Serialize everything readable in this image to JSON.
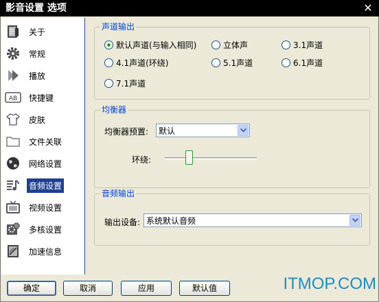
{
  "window": {
    "title": "影音设置 选项",
    "close_glyph": "✕"
  },
  "sidebar": {
    "items": [
      {
        "label": "关于",
        "icon": "about-icon"
      },
      {
        "label": "常规",
        "icon": "gear-icon"
      },
      {
        "label": "播放",
        "icon": "play-icon"
      },
      {
        "label": "快捷键",
        "icon": "keyboard-icon"
      },
      {
        "label": "皮肤",
        "icon": "shirt-icon"
      },
      {
        "label": "文件关联",
        "icon": "folder-icon"
      },
      {
        "label": "网络设置",
        "icon": "globe-icon"
      },
      {
        "label": "音频设置",
        "icon": "audio-icon",
        "selected": true
      },
      {
        "label": "视频设置",
        "icon": "tv-icon"
      },
      {
        "label": "多核设置",
        "icon": "multicore-icon"
      },
      {
        "label": "加速信息",
        "icon": "speed-icon"
      }
    ]
  },
  "channel_output": {
    "title": "声道输出",
    "options": [
      {
        "label": "默认声道(与输入相同)",
        "checked": true
      },
      {
        "label": "立体声",
        "checked": false
      },
      {
        "label": "3.1声道",
        "checked": false
      },
      {
        "label": "4.1声道(环绕)",
        "checked": false
      },
      {
        "label": "5.1声道",
        "checked": false
      },
      {
        "label": "6.1声道",
        "checked": false
      },
      {
        "label": "7.1声道",
        "checked": false
      }
    ]
  },
  "equalizer": {
    "title": "均衡器",
    "preset_label": "均衡器预置:",
    "preset_value": "默认",
    "surround_label": "环绕:",
    "surround_level": 0.0
  },
  "audio_output": {
    "title": "音频输出",
    "device_label": "输出设备:",
    "device_value": "系统默认音频"
  },
  "buttons": {
    "ok": "确定",
    "cancel": "取消",
    "apply": "应用",
    "default": "默认值"
  },
  "watermark": "ITMOP.COM",
  "colors": {
    "accent": "#0046d5",
    "selected_bg": "#1f3f8f",
    "watermark": "#1b8ec2"
  }
}
